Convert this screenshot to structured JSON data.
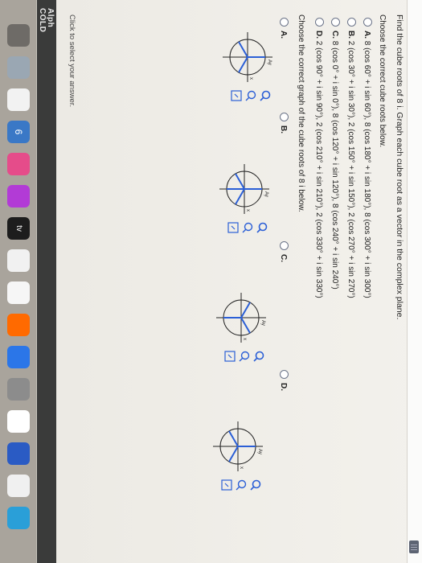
{
  "question": "Find the cube roots of 8 i. Graph each cube root as a vector in the complex plane.",
  "prompt1": "Choose the correct cube roots below.",
  "options": [
    {
      "letter": "A.",
      "text": "8 (cos 60° + i sin 60°), 8 (cos 180° + i sin 180°), 8 (cos 300° + i sin 300°)"
    },
    {
      "letter": "B.",
      "text": "2 (cos 30° + i sin 30°), 2 (cos 150° + i sin 150°), 2 (cos 270° + i sin 270°)"
    },
    {
      "letter": "C.",
      "text": "8 (cos 0° + i sin 0°), 8 (cos 120° + i sin 120°), 8 (cos 240° + i sin 240°)"
    },
    {
      "letter": "D.",
      "text": "2 (cos 90° + i sin 90°), 2 (cos 210° + i sin 210°), 2 (cos 330° + i sin 330°)"
    }
  ],
  "prompt2": "Choose the correct graph of the cube roots of 8 i below.",
  "graph_options": [
    "A.",
    "B.",
    "C.",
    "D."
  ],
  "axis_labels": {
    "y": "Ay",
    "x": "x"
  },
  "hint": "Click to select your answer.",
  "side_brand": "Alph",
  "side_brand2": "COLD",
  "dock_text": "6",
  "dock_tv": "tv",
  "colors": {
    "accent": "#1e64c8",
    "vector": "#2b5fd6",
    "circle": "#222222"
  }
}
